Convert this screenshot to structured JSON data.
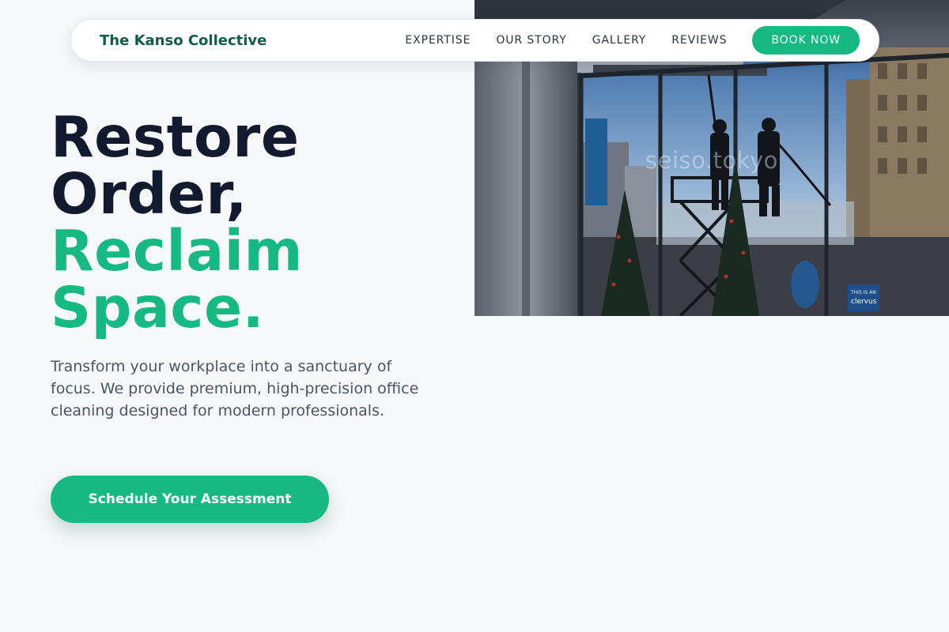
{
  "nav": {
    "brand": "The Kanso Collective",
    "links": [
      "EXPERTISE",
      "OUR STORY",
      "GALLERY",
      "REVIEWS"
    ],
    "cta_label": "BOOK NOW"
  },
  "hero": {
    "headline_line1": "Restore",
    "headline_line2": "Order,",
    "headline_line3": "Reclaim",
    "headline_line4": "Space.",
    "subtext": "Transform your workplace into a sanctuary of focus. We provide premium, high-precision office cleaning designed for modern professionals.",
    "cta_label": "Schedule Your Assessment",
    "image": {
      "watermark": "seiso.tokyo",
      "sign_text_1": "THIS IS AN",
      "sign_text_2": "clervus"
    }
  },
  "colors": {
    "accent": "#16b981",
    "brand_text": "#0e5e44",
    "headline_dark": "#111a2e",
    "background": "#f6f8fa"
  }
}
